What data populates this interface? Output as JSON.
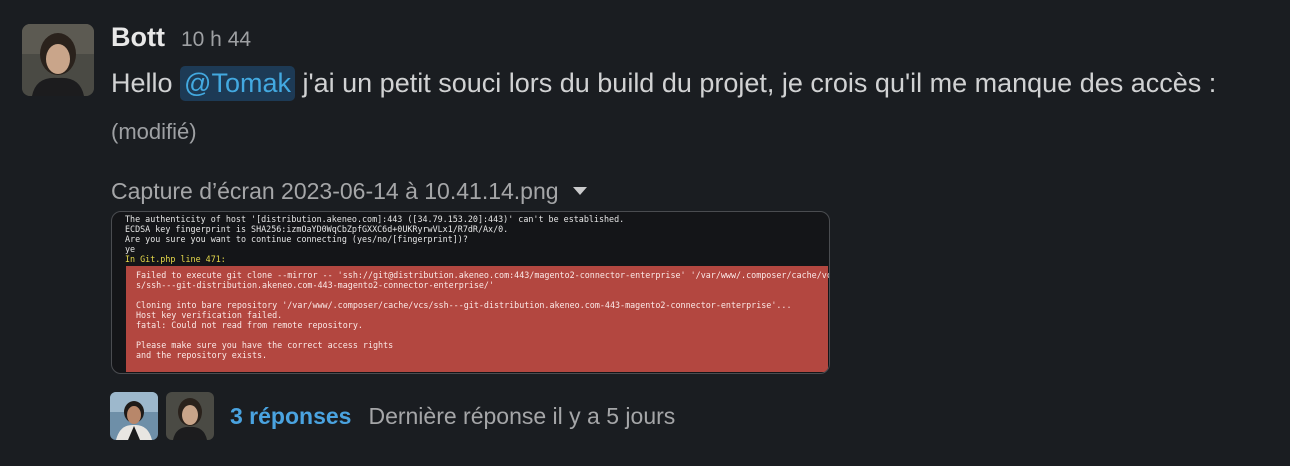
{
  "message": {
    "author": "Bott",
    "time": "10 h 44",
    "text_before": "Hello ",
    "mention": "@Tomak",
    "text_after": " j'ai un petit souci lors du build du projet, je crois qu'il me manque des accès : ",
    "edited_label": "(modifié)"
  },
  "attachment": {
    "filename": "Capture d’écran 2023-06-14 à 10.41.14.png",
    "terminal": {
      "line1": "The authenticity of host '[distribution.akeneo.com]:443 ([34.79.153.20]:443)' can't be established.",
      "line2": "ECDSA key fingerprint is SHA256:izmOaYD0WqCbZpfGXXC6d+0UKRyrwVLx1/R7dR/Ax/0.",
      "line3": "Are you sure you want to continue connecting (yes/no/[fingerprint])?",
      "line4": "ye",
      "line5": "In Git.php line 471:",
      "error": {
        "line1": "Failed to execute git clone --mirror -- 'ssh://git@distribution.akeneo.com:443/magento2-connector-enterprise' '/var/www/.composer/cache/vc",
        "line2": "s/ssh---git-distribution.akeneo.com-443-magento2-connector-enterprise/'",
        "line3": "Cloning into bare repository '/var/www/.composer/cache/vcs/ssh---git-distribution.akeneo.com-443-magento2-connector-enterprise'...",
        "line4": "Host key verification failed.",
        "line5": "fatal: Could not read from remote repository.",
        "line6": "Please make sure you have the correct access rights",
        "line7": "and the repository exists."
      }
    }
  },
  "thread": {
    "reply_count": "3 réponses",
    "last_reply": "Dernière réponse il y a 5 jours"
  },
  "colors": {
    "background": "#1a1d21",
    "mention_bg": "#1d3a55",
    "link": "#4aa3e0",
    "error_bg": "#b34740"
  }
}
